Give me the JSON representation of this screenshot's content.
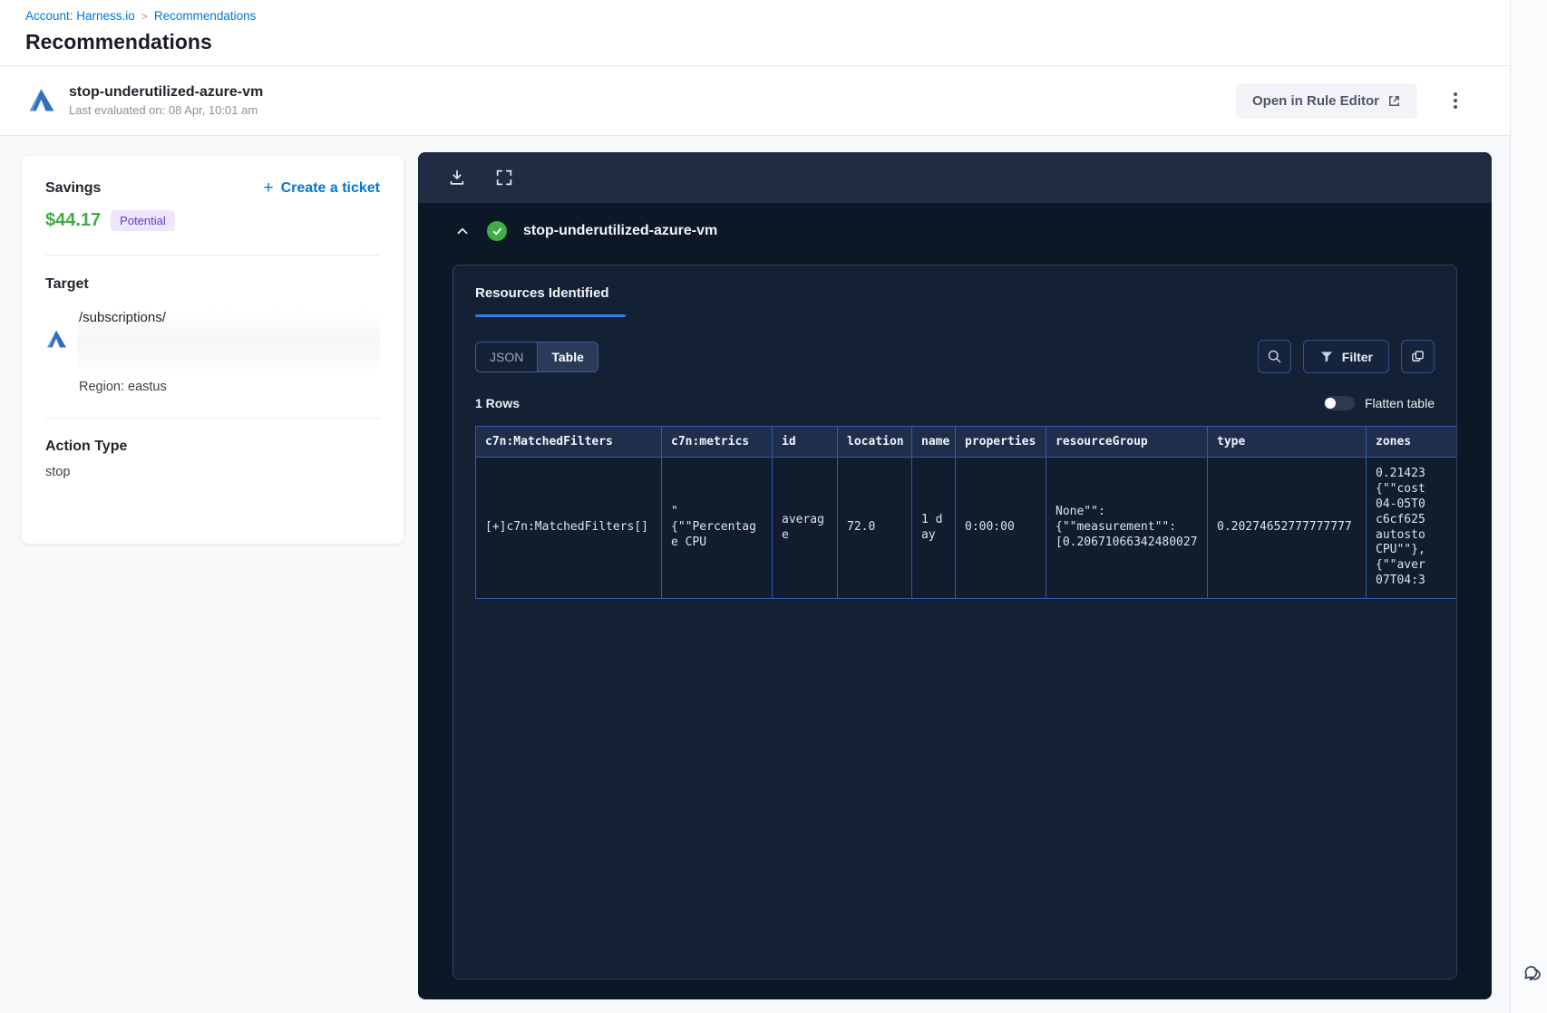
{
  "breadcrumb": {
    "account": "Account: Harness.io",
    "separator": ">",
    "current": "Recommendations"
  },
  "page": {
    "title": "Recommendations"
  },
  "recommendation_header": {
    "name": "stop-underutilized-azure-vm",
    "last_evaluated": "Last evaluated on: 08 Apr, 10:01 am",
    "open_in_rule_editor": "Open in Rule Editor"
  },
  "summary_card": {
    "savings_label": "Savings",
    "savings_amount": "$44.17",
    "savings_badge": "Potential",
    "create_ticket_label": "Create a ticket",
    "plus": "+",
    "target_label": "Target",
    "target_path": "/subscriptions/",
    "region": "Region: eastus",
    "action_type_label": "Action Type",
    "action_type_value": "stop"
  },
  "viewer": {
    "title": "stop-underutilized-azure-vm",
    "tab_label": "Resources Identified",
    "view_toggle": {
      "json": "JSON",
      "table": "Table",
      "active": "Table"
    },
    "filter_label": "Filter",
    "rows_count": "1 Rows",
    "flatten_label": "Flatten table",
    "table": {
      "columns": [
        "c7n:MatchedFilters",
        "c7n:metrics",
        "id",
        "location",
        "name",
        "properties",
        "resourceGroup",
        "type",
        "zones"
      ],
      "row": {
        "c7n_matched_filters": "[+]c7n:MatchedFilters[]",
        "c7n_metrics": "\"\n{\"\"Percentage CPU",
        "id": "average",
        "location": "72.0",
        "name": "1 day",
        "properties": "0:00:00",
        "resourceGroup": "None\"\":\n{\"\"measurement\"\":\n[0.20671066342480027",
        "type": "0.20274652777777777",
        "zones": "0.21423\n{\"\"cost\n04-05T0\nc6cf625\nautosto\nCPU\"\"},\n{\"\"aver\n07T04:3"
      }
    }
  },
  "colors": {
    "accent_blue": "#0278d5",
    "savings_green": "#42ab45",
    "badge_purple_bg": "#ece7fc",
    "badge_purple_text": "#6237cf",
    "panel_dark": "#0d1826",
    "panel_toolbar": "#1f2c41",
    "table_border_blue": "#2d5cad",
    "success_green": "#3fae49"
  }
}
